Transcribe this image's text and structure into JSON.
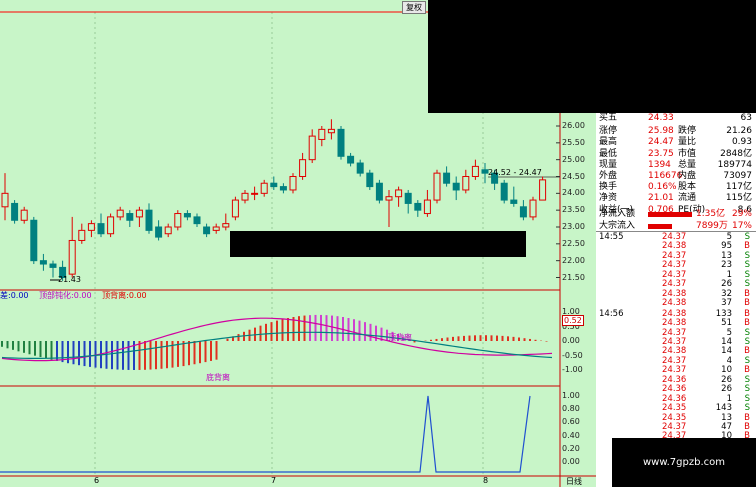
{
  "toolbar": {
    "fuquan_label": "复权"
  },
  "price_axis": [
    "26.00",
    "25.50",
    "25.00",
    "24.50",
    "24.00",
    "23.50",
    "23.00",
    "22.50",
    "22.00",
    "21.50"
  ],
  "macd_axis": [
    "1.00",
    "0.50",
    "0.00",
    "-0.50",
    "-1.00"
  ],
  "macd_current": "0.52",
  "osc_axis": [
    "1.00",
    "0.80",
    "0.60",
    "0.40",
    "0.20",
    "0.00"
  ],
  "annotations": {
    "low_price": "21.43",
    "range_label": "24.52 - 24.47",
    "top_div_label": "顶背离",
    "bottom_div_label": "底背离",
    "legend_dif_label": "差:",
    "legend_dif": "0.00",
    "legend_top_label": "顶部钝化:",
    "legend_top": "0.00",
    "legend_div_label": "顶背离:",
    "legend_div": "0.00"
  },
  "x_axis": {
    "labels": [
      "6",
      "7",
      "8"
    ],
    "period": "日线"
  },
  "quote": {
    "rows": [
      {
        "l1": "买五",
        "v1": "24.33",
        "l2": "",
        "v2": "63"
      },
      {
        "l1": "涨停",
        "v1": "25.98",
        "l2": "跌停",
        "v2": "21.26"
      },
      {
        "l1": "最高",
        "v1": "24.47",
        "l2": "量比",
        "v2": "0.93"
      },
      {
        "l1": "最低",
        "v1": "23.75",
        "l2": "市值",
        "v2": "2848亿"
      },
      {
        "l1": "现量",
        "v1": "1394",
        "l2": "总量",
        "v2": "189774"
      },
      {
        "l1": "外盘",
        "v1": "116676",
        "l2": "内盘",
        "v2": "73097"
      },
      {
        "l1": "换手",
        "v1": "0.16%",
        "l2": "股本",
        "v2": "117亿"
      },
      {
        "l1": "净资",
        "v1": "21.01",
        "l2": "流通",
        "v2": "115亿"
      },
      {
        "l1": "收益(一)",
        "v1": "0.706",
        "l2": "PE(动)",
        "v2": "8.6"
      }
    ],
    "flows": [
      {
        "label": "净流入额",
        "value": "1.35亿",
        "pct": "29%"
      },
      {
        "label": "大宗流入",
        "value": "7899万",
        "pct": "17%"
      }
    ]
  },
  "ticks": [
    {
      "time": "14:55",
      "price": "24.37",
      "vol": "5",
      "side": "S"
    },
    {
      "time": "",
      "price": "24.38",
      "vol": "95",
      "side": "B"
    },
    {
      "time": "",
      "price": "24.37",
      "vol": "13",
      "side": "S"
    },
    {
      "time": "",
      "price": "24.37",
      "vol": "23",
      "side": "S"
    },
    {
      "time": "",
      "price": "24.37",
      "vol": "1",
      "side": "S"
    },
    {
      "time": "",
      "price": "24.37",
      "vol": "26",
      "side": "S"
    },
    {
      "time": "",
      "price": "24.38",
      "vol": "32",
      "side": "B"
    },
    {
      "time": "",
      "price": "24.38",
      "vol": "37",
      "side": "B"
    },
    {
      "time": "14:56",
      "price": "24.38",
      "vol": "133",
      "side": "B"
    },
    {
      "time": "",
      "price": "24.38",
      "vol": "51",
      "side": "B"
    },
    {
      "time": "",
      "price": "24.37",
      "vol": "5",
      "side": "S"
    },
    {
      "time": "",
      "price": "24.37",
      "vol": "14",
      "side": "S"
    },
    {
      "time": "",
      "price": "24.38",
      "vol": "14",
      "side": "B"
    },
    {
      "time": "",
      "price": "24.37",
      "vol": "4",
      "side": "S"
    },
    {
      "time": "",
      "price": "24.37",
      "vol": "10",
      "side": "B"
    },
    {
      "time": "",
      "price": "24.36",
      "vol": "26",
      "side": "S"
    },
    {
      "time": "",
      "price": "24.36",
      "vol": "26",
      "side": "S"
    },
    {
      "time": "",
      "price": "24.36",
      "vol": "1",
      "side": "S"
    },
    {
      "time": "",
      "price": "24.35",
      "vol": "143",
      "side": "S"
    },
    {
      "time": "",
      "price": "24.35",
      "vol": "13",
      "side": "B"
    },
    {
      "time": "",
      "price": "24.37",
      "vol": "47",
      "side": "B"
    },
    {
      "time": "",
      "price": "24.37",
      "vol": "10",
      "side": "B"
    }
  ],
  "watermark": "www.7gpzb.com",
  "colors": {
    "up": "#e00000",
    "down": "#008080",
    "bg": "#c8f5c8",
    "dif": "#d000a0",
    "dea": "#008080",
    "osc": "#2050d0"
  },
  "chart_data": {
    "type": "candlestick",
    "candles": [
      [
        23.6,
        24.0,
        23.2,
        24.6
      ],
      [
        23.7,
        23.2,
        23.1,
        23.8
      ],
      [
        23.2,
        23.5,
        23.1,
        23.6
      ],
      [
        23.2,
        22.0,
        21.9,
        23.3
      ],
      [
        22.0,
        21.9,
        21.7,
        22.2
      ],
      [
        21.9,
        21.8,
        21.5,
        22.0
      ],
      [
        21.8,
        21.5,
        21.4,
        22.0
      ],
      [
        21.6,
        22.6,
        21.5,
        23.3
      ],
      [
        22.6,
        22.9,
        22.5,
        23.1
      ],
      [
        22.9,
        23.1,
        22.7,
        23.2
      ],
      [
        23.1,
        22.8,
        22.7,
        23.4
      ],
      [
        22.8,
        23.3,
        22.7,
        23.4
      ],
      [
        23.3,
        23.5,
        23.2,
        23.6
      ],
      [
        23.4,
        23.2,
        23.0,
        23.5
      ],
      [
        23.3,
        23.5,
        23.0,
        23.6
      ],
      [
        23.5,
        22.9,
        22.8,
        23.7
      ],
      [
        23.0,
        22.7,
        22.6,
        23.2
      ],
      [
        22.8,
        23.0,
        22.7,
        23.1
      ],
      [
        23.0,
        23.4,
        22.9,
        23.5
      ],
      [
        23.4,
        23.3,
        23.2,
        23.5
      ],
      [
        23.3,
        23.1,
        23.0,
        23.4
      ],
      [
        23.0,
        22.8,
        22.7,
        23.1
      ],
      [
        22.9,
        23.0,
        22.8,
        23.1
      ],
      [
        23.0,
        23.1,
        22.9,
        23.4
      ],
      [
        23.3,
        23.8,
        23.2,
        23.9
      ],
      [
        23.8,
        24.0,
        23.7,
        24.1
      ],
      [
        24.0,
        24.0,
        23.8,
        24.2
      ],
      [
        24.0,
        24.3,
        23.9,
        24.4
      ],
      [
        24.3,
        24.2,
        24.1,
        24.5
      ],
      [
        24.2,
        24.1,
        24.0,
        24.3
      ],
      [
        24.1,
        24.5,
        24.0,
        24.6
      ],
      [
        24.5,
        25.0,
        24.4,
        25.2
      ],
      [
        25.0,
        25.7,
        24.9,
        25.9
      ],
      [
        25.6,
        25.9,
        25.4,
        26.0
      ],
      [
        25.8,
        25.9,
        25.6,
        26.2
      ],
      [
        25.9,
        25.1,
        25.0,
        26.0
      ],
      [
        25.1,
        24.9,
        24.8,
        25.2
      ],
      [
        24.9,
        24.6,
        24.5,
        25.0
      ],
      [
        24.6,
        24.2,
        24.1,
        24.7
      ],
      [
        24.3,
        23.8,
        23.7,
        24.4
      ],
      [
        23.8,
        23.9,
        23.0,
        24.1
      ],
      [
        23.9,
        24.1,
        23.6,
        24.2
      ],
      [
        24.0,
        23.7,
        23.4,
        24.1
      ],
      [
        23.7,
        23.5,
        23.3,
        23.8
      ],
      [
        23.4,
        23.8,
        23.3,
        24.1
      ],
      [
        23.8,
        24.6,
        23.7,
        24.7
      ],
      [
        24.6,
        24.3,
        24.2,
        24.8
      ],
      [
        24.3,
        24.1,
        23.8,
        24.5
      ],
      [
        24.1,
        24.5,
        24.0,
        24.7
      ],
      [
        24.5,
        24.8,
        24.4,
        25.0
      ],
      [
        24.7,
        24.6,
        24.3,
        24.9
      ],
      [
        24.6,
        24.3,
        24.1,
        24.7
      ],
      [
        24.3,
        23.8,
        23.7,
        24.4
      ],
      [
        23.8,
        23.7,
        23.6,
        24.2
      ],
      [
        23.6,
        23.3,
        23.2,
        23.8
      ],
      [
        23.3,
        23.8,
        23.2,
        23.9
      ],
      [
        23.8,
        24.4,
        23.8,
        24.5
      ]
    ],
    "xlabel": "",
    "ylabel": "",
    "ylim": [
      21.2,
      26.4
    ]
  }
}
